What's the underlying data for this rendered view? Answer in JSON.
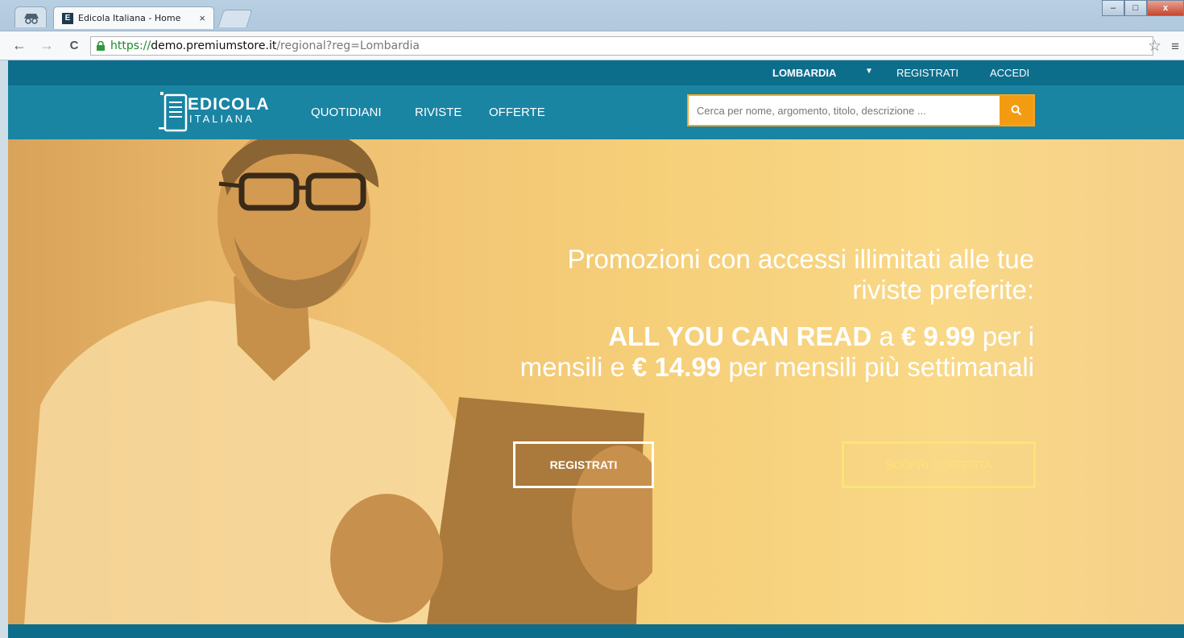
{
  "browser": {
    "tab_title": "Edicola Italiana - Home",
    "tab_close": "×",
    "favicon_letter": "E",
    "url_scheme": "https://",
    "url_host": "demo.premiumstore.it",
    "url_path": "/regional?reg=Lombardia",
    "back": "←",
    "forward": "→",
    "reload": "C",
    "star": "☆",
    "menu": "≡",
    "minimize": "–",
    "maximize": "□",
    "close": "x"
  },
  "topbar": {
    "region": "LOMBARDIA",
    "region_caret": "▼",
    "register": "REGISTRATI",
    "login": "ACCEDI"
  },
  "logo": {
    "line1": "EDICOLA",
    "line2": "ITALIANA"
  },
  "nav": [
    "QUOTIDIANI",
    "RIVISTE",
    "OFFERTE"
  ],
  "search": {
    "placeholder": "Cerca per nome, argomento, titolo, descrizione ...",
    "icon": "search-icon"
  },
  "hero": {
    "headline": "Promozioni con accessi illimitati alle tue riviste preferite:",
    "offer_bold1": "ALL YOU CAN READ",
    "offer_t1": " a ",
    "offer_bold2": "€ 9.99",
    "offer_t2": " per i mensili e ",
    "offer_bold3": "€ 14.99",
    "offer_t3": " per mensili più settimanali",
    "cta_register": "REGISTRATI",
    "cta_offer": "SCOPRI L'OFFERTA"
  },
  "colors": {
    "header_dark": "#0d6e8c",
    "header": "#1a84a3",
    "accent": "#f39c12",
    "hero": "#f6cf79"
  }
}
